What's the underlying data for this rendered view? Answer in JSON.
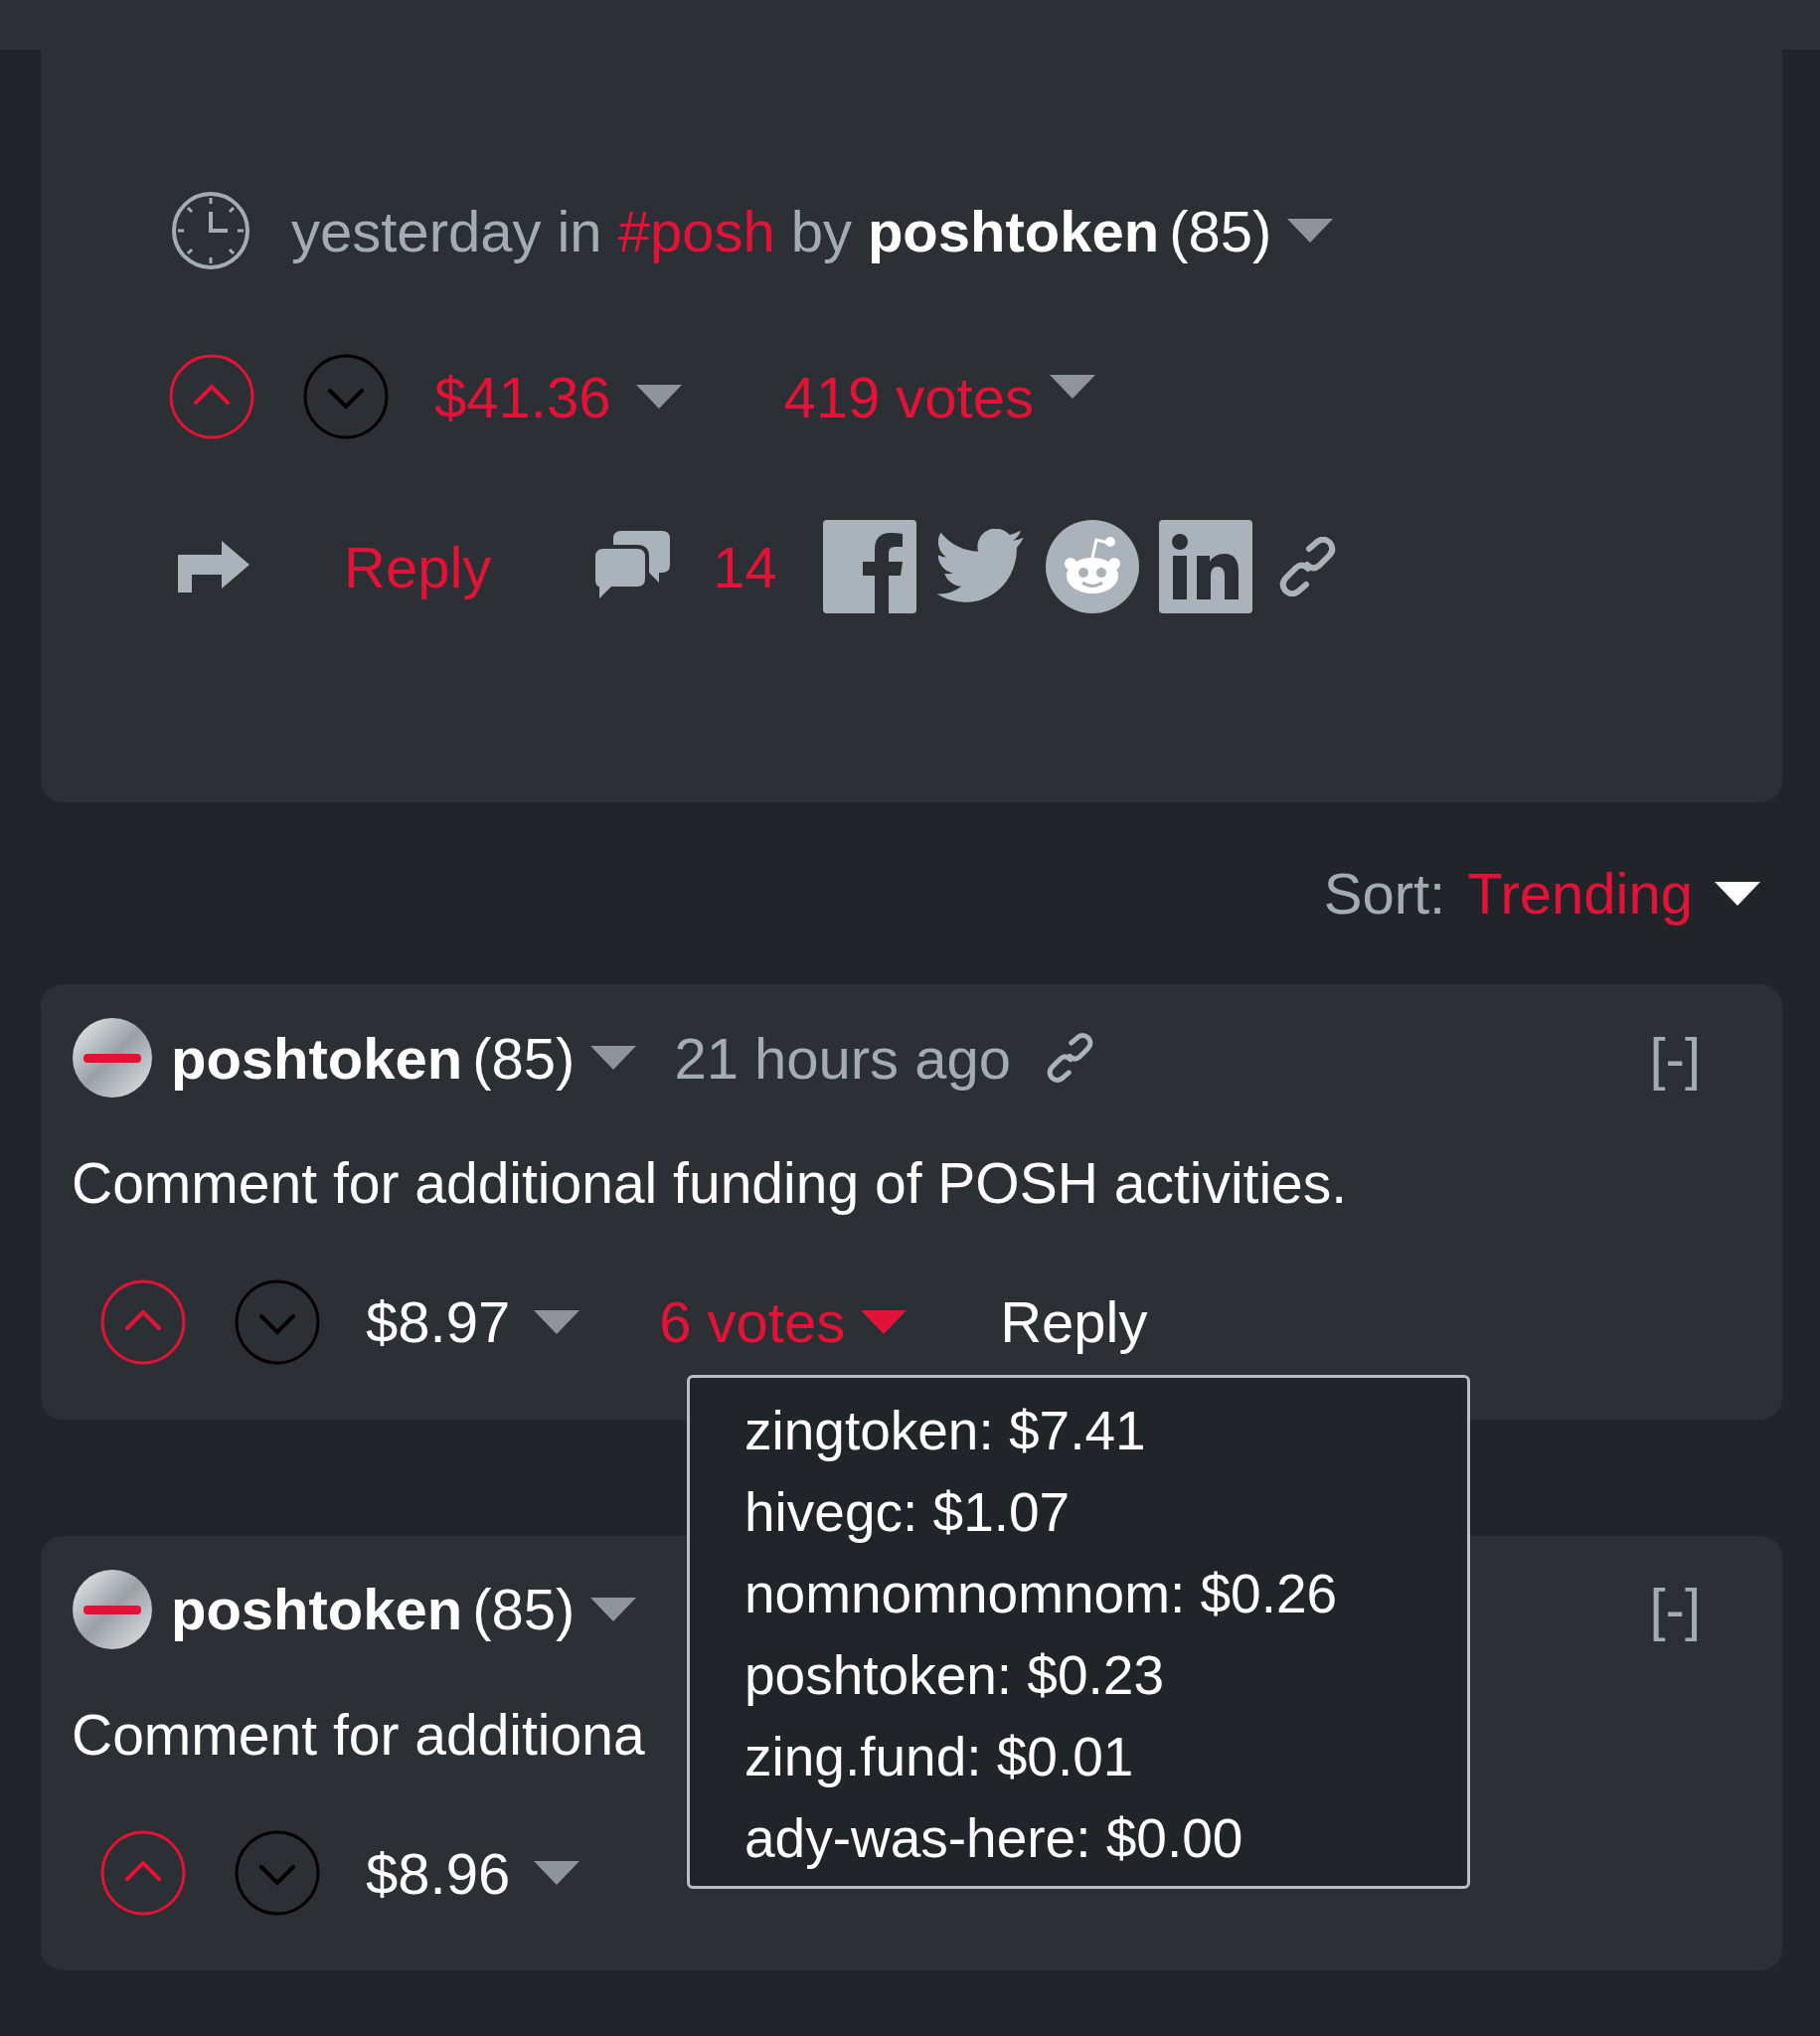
{
  "post": {
    "time": "yesterday",
    "in_word": "in",
    "tag": "#posh",
    "by_word": "by",
    "author": "poshtoken",
    "reputation": "(85)",
    "upvoted": true,
    "downvoted": false,
    "payout": "$41.36",
    "votes": "419 votes",
    "votes_open": false,
    "reply": "Reply",
    "comment_count": "14"
  },
  "sort": {
    "label": "Sort:",
    "value": "Trending"
  },
  "comments": [
    {
      "author": "poshtoken",
      "reputation": "(85)",
      "time": "21 hours ago",
      "collapse": "[-]",
      "body": "Comment for additional funding of POSH activities.",
      "upvoted": true,
      "downvoted": false,
      "payout": "$8.97",
      "votes": "6 votes",
      "votes_open": true,
      "reply": "Reply",
      "voters": [
        "zingtoken: $7.41",
        "hivegc: $1.07",
        "nomnomnomnom: $0.26",
        "poshtoken: $0.23",
        "zing.fund: $0.01",
        "ady-was-here: $0.00"
      ]
    },
    {
      "author": "poshtoken",
      "reputation": "(85)",
      "collapse": "[-]",
      "body": "Comment for additiona",
      "upvoted": true,
      "downvoted": false,
      "payout": "$8.96"
    }
  ]
}
